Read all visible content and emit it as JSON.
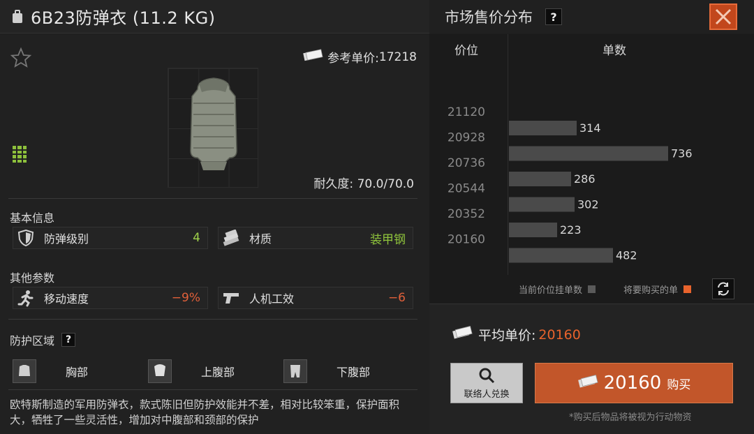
{
  "header": {
    "item_title": "6B23防弹衣 (11.2 KG)",
    "market_title": "市场售价分布",
    "help_symbol": "?",
    "close_icon": "close-x-icon"
  },
  "item": {
    "ref_price_label": "参考单价:",
    "ref_price": "17218",
    "durability_label": "耐久度:",
    "durability": "70.0/70.0"
  },
  "basic_info": {
    "label": "基本信息",
    "stats": [
      {
        "label": "防弹级别",
        "value": "4",
        "color": "#9ed04a",
        "icon": "shield-icon"
      },
      {
        "label": "材质",
        "value": "装甲钢",
        "color": "#8fc43c",
        "icon": "material-icon"
      }
    ]
  },
  "other_params": {
    "label": "其他参数",
    "stats": [
      {
        "label": "移动速度",
        "value": "−9%",
        "color": "#e0603a",
        "icon": "running-icon"
      },
      {
        "label": "人机工效",
        "value": "−6",
        "color": "#e0603a",
        "icon": "pistol-icon"
      }
    ]
  },
  "protection": {
    "label": "防护区域",
    "help": "?",
    "zones": [
      "胸部",
      "上腹部",
      "下腹部"
    ]
  },
  "description": "欧特斯制造的军用防弹衣，款式陈旧但防护效能并不差，相对比较笨重，保护面积大，牺牲了一些灵活性，增加对中腹部和颈部的保护",
  "market": {
    "col_price": "价位",
    "col_count": "单数",
    "legend_current": "当前价位挂单数",
    "legend_buy": "将要购买的单",
    "legend_current_color": "#5a5a5a",
    "legend_buy_color": "#e8632c"
  },
  "chart_data": {
    "type": "bar",
    "orientation": "horizontal",
    "y_ticks": [
      "21120",
      "20928",
      "20736",
      "20544",
      "20352",
      "20160"
    ],
    "bars": [
      {
        "value": 314
      },
      {
        "value": 736
      },
      {
        "value": 286
      },
      {
        "value": 302
      },
      {
        "value": 223
      },
      {
        "value": 482
      }
    ],
    "xlim": [
      0,
      736
    ]
  },
  "purchase": {
    "avg_label": "平均单价:",
    "avg_price": "20160",
    "exchange_label": "联络人兑换",
    "buy_amount": "20160",
    "buy_label": "购买",
    "note": "*购买后物品将被视为行动物资"
  }
}
